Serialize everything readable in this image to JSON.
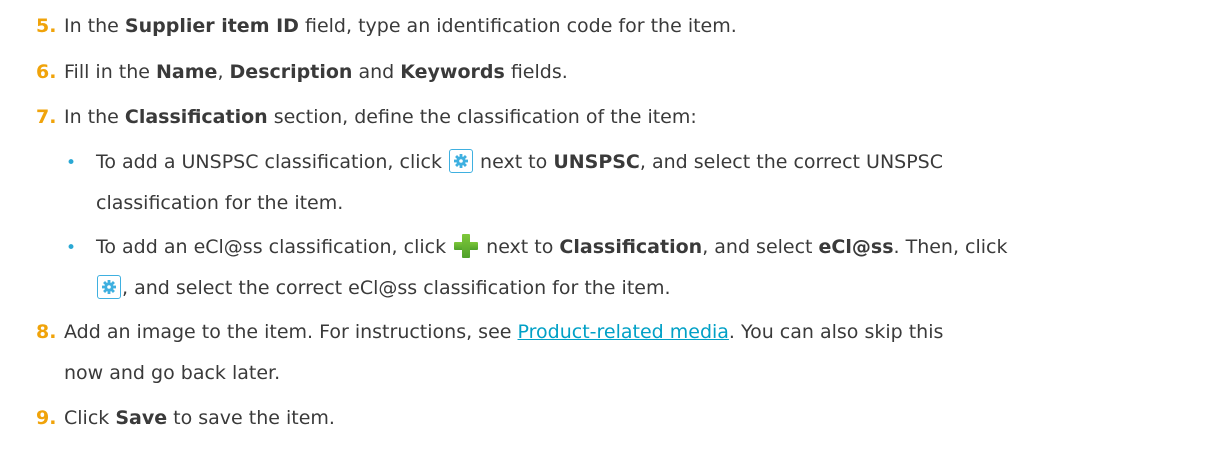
{
  "steps": {
    "s5": {
      "num": "5.",
      "t1": "In the ",
      "b1": "Supplier item ID",
      "t2": " field, type an identification code for the item."
    },
    "s6": {
      "num": "6.",
      "t1": "Fill in the ",
      "b1": "Name",
      "t2": ", ",
      "b2": "Description",
      "t3": " and ",
      "b3": "Keywords",
      "t4": " fields."
    },
    "s7": {
      "num": "7.",
      "t1": "In the ",
      "b1": "Classification",
      "t2": " section, define the classification of the item:",
      "bullet1": {
        "t1": "To add a UNSPSC classification, click ",
        "t2": " next to ",
        "b1": "UNSPSC",
        "t3": ", and select the correct UNSPSC",
        "t4": "classification for the item."
      },
      "bullet2": {
        "t1": "To add an eCl@ss classification, click ",
        "t2": " next to ",
        "b1": "Classification",
        "t3": ", and select ",
        "b2": "eCl@ss",
        "t4": ". Then, click",
        "t5": ", and select the correct eCl@ss classification for the item."
      }
    },
    "s8": {
      "num": "8.",
      "t1": "Add an image to the item. For instructions, see ",
      "link": "Product-related media",
      "t2": ". You can also skip this",
      "t3": "now and go back later."
    },
    "s9": {
      "num": "9.",
      "t1": "Click ",
      "b1": "Save",
      "t2": " to save the item."
    }
  },
  "icons": {
    "gear": "gear-icon",
    "plus": "plus-icon",
    "bullet": "•"
  },
  "colors": {
    "step_number": "#f0a30a",
    "link": "#00a0c6",
    "icon_border": "#3fb0e0",
    "plus_green": "#5cb030"
  }
}
